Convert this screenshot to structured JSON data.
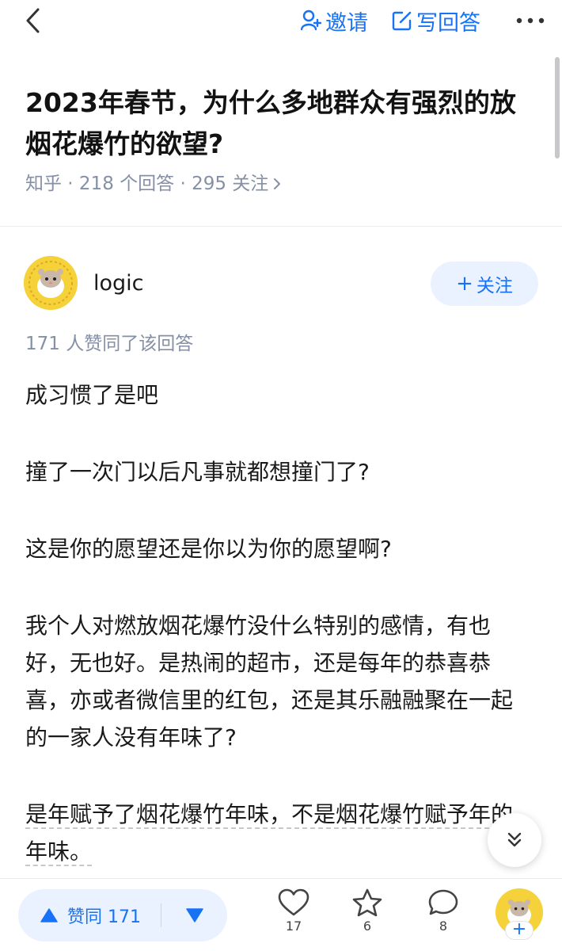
{
  "header": {
    "invite_label": "邀请",
    "write_label": "写回答"
  },
  "question": {
    "title": "2023年春节，为什么多地群众有强烈的放烟花爆竹的欲望?",
    "meta": "知乎 · 218 个回答 · 295 关注"
  },
  "author": {
    "name": "logic",
    "follow_label": "关注"
  },
  "answer": {
    "agree_text": "171 人赞同了该回答",
    "paragraphs": [
      "成习惯了是吧",
      "撞了一次门以后凡事就都想撞门了?",
      "这是你的愿望还是你以为你的愿望啊?",
      "我个人对燃放烟花爆竹没什么特别的感情，有也好，无也好。是热闹的超市，还是每年的恭喜恭喜，亦或者微信里的红包，还是其乐融融聚在一起的一家人没有年味了?",
      "是年赋予了烟花爆竹年味，不是烟花爆竹赋予年的年味。"
    ]
  },
  "bottom_bar": {
    "vote_label": "赞同 171",
    "likes_count": "17",
    "favorites_count": "6",
    "comments_count": "8"
  },
  "colors": {
    "accent": "#1772f6",
    "accent_bg": "#ebf2ff",
    "meta_gray": "#8590a6",
    "avatar_yellow": "#f5d13a"
  },
  "icons": [
    "back-icon",
    "invite-icon",
    "edit-icon",
    "more-icon",
    "chevron-right-icon",
    "plus-icon",
    "scroll-down-icon",
    "vote-up-icon",
    "vote-down-icon",
    "heart-icon",
    "star-icon",
    "comment-icon"
  ]
}
